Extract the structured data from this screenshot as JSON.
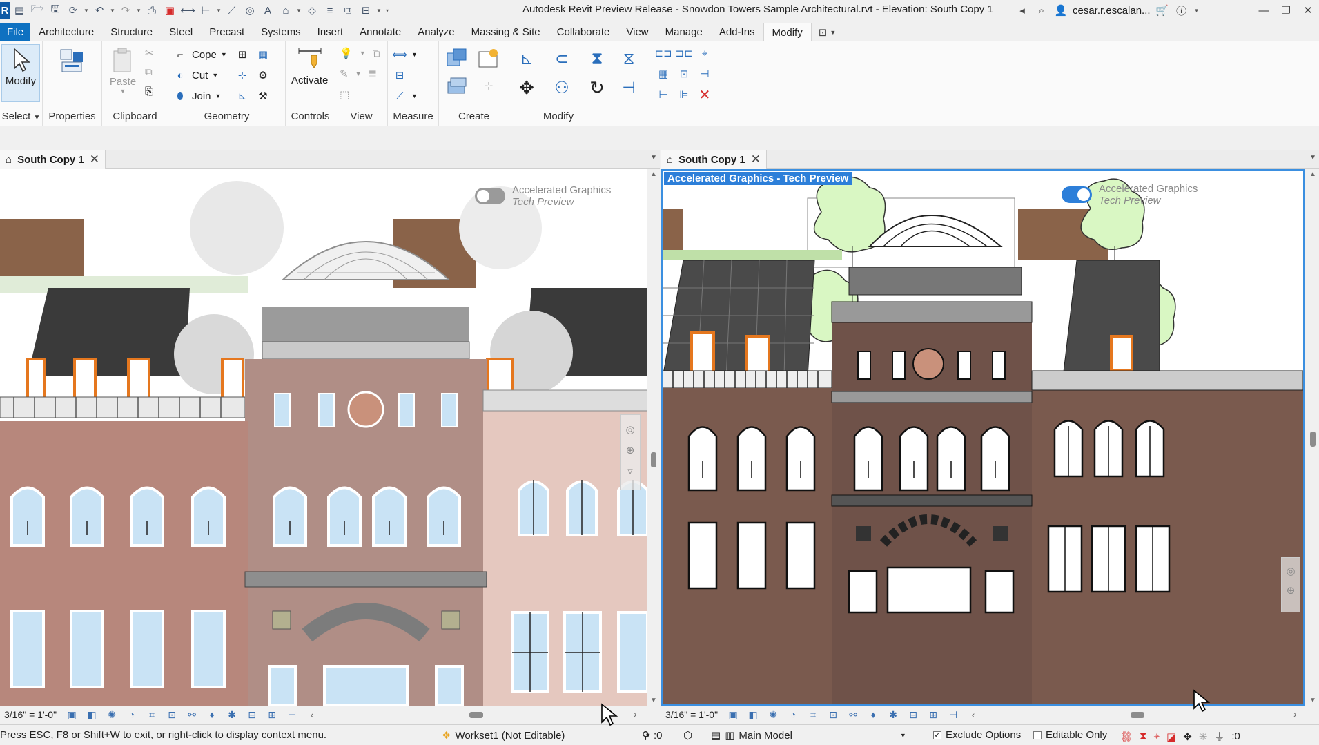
{
  "window": {
    "title": "Autodesk Revit Preview Release - Snowdon Towers Sample Architectural.rvt - Elevation: South Copy 1",
    "user": "cesar.r.escalan...",
    "app_logo": "R"
  },
  "ribbon_tabs": [
    "File",
    "Architecture",
    "Structure",
    "Steel",
    "Precast",
    "Systems",
    "Insert",
    "Annotate",
    "Analyze",
    "Massing & Site",
    "Collaborate",
    "View",
    "Manage",
    "Add-Ins",
    "Modify"
  ],
  "active_tab": "Modify",
  "ribbon": {
    "select": {
      "modify_label": "Modify",
      "panel_label": "Select"
    },
    "properties": {
      "panel_label": "Properties"
    },
    "clipboard": {
      "paste_label": "Paste",
      "panel_label": "Clipboard"
    },
    "geometry": {
      "cope_label": "Cope",
      "cut_label": "Cut",
      "join_label": "Join",
      "panel_label": "Geometry"
    },
    "controls": {
      "activate_label": "Activate",
      "panel_label": "Controls"
    },
    "view": {
      "panel_label": "View"
    },
    "measure": {
      "panel_label": "Measure"
    },
    "create": {
      "panel_label": "Create"
    },
    "modify": {
      "panel_label": "Modify"
    }
  },
  "views": {
    "left": {
      "tab_label": "South Copy 1",
      "accel_label": "Accelerated Graphics",
      "accel_sub": "Tech Preview",
      "accel_enabled": false,
      "scale": "3/16\" = 1'-0\""
    },
    "right": {
      "tab_label": "South Copy 1",
      "banner": "Accelerated Graphics - Tech Preview",
      "accel_label": "Accelerated Graphics",
      "accel_sub": "Tech Preview",
      "accel_enabled": true,
      "scale": "3/16\" = 1'-0\""
    }
  },
  "statusbar": {
    "message": "Press ESC, F8 or Shift+W to exit, or right-click to display context menu.",
    "workset": "Workset1 (Not Editable)",
    "zero_count": ":0",
    "model": "Main Model",
    "exclude_options": "Exclude Options",
    "editable_only": "Editable Only",
    "filter_count": ":0"
  },
  "colors": {
    "accent": "#0e71c1",
    "highlight": "#3b8fe0",
    "brick": "#7a5a4e",
    "tree_fill": "#d9f7c3"
  }
}
